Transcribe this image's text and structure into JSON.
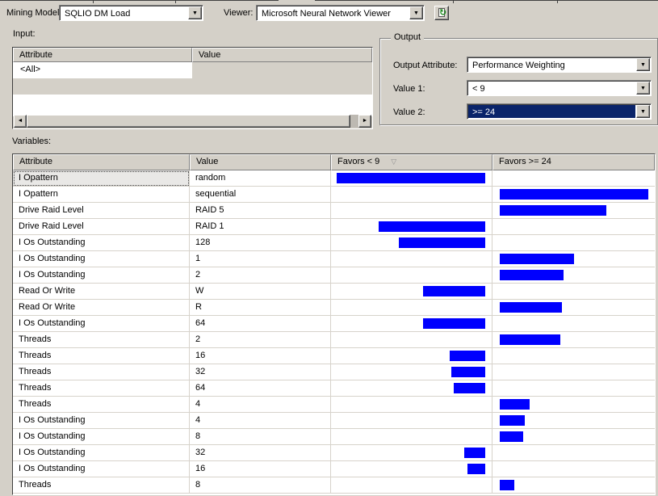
{
  "colors": {
    "bar": "#0000fe",
    "selection": "#0a246a",
    "chrome": "#d4d0c8"
  },
  "toolbar": {
    "mining_model_label": "Mining Model:",
    "mining_model_value": "SQLIO DM Load",
    "viewer_label": "Viewer:",
    "viewer_value": "Microsoft Neural Network Viewer"
  },
  "input": {
    "label": "Input:",
    "columns": [
      "Attribute",
      "Value"
    ],
    "rows": [
      {
        "attribute": "<All>",
        "value": ""
      }
    ]
  },
  "output": {
    "legend": "Output",
    "output_attribute_label": "Output Attribute:",
    "output_attribute_value": "Performance Weighting",
    "value1_label": "Value 1:",
    "value1_value": "< 9",
    "value2_label": "Value 2:",
    "value2_value": ">= 24"
  },
  "variables": {
    "label": "Variables:",
    "columns": [
      "Attribute",
      "Value",
      "Favors < 9",
      "Favors >= 24"
    ],
    "sorted_by": "Favors < 9",
    "rows": [
      {
        "attribute": "I Opattern",
        "value": "random",
        "favors": "lt",
        "size": 100,
        "selected": true
      },
      {
        "attribute": "I Opattern",
        "value": "sequential",
        "favors": "ge",
        "size": 100
      },
      {
        "attribute": "Drive Raid Level",
        "value": "RAID 5",
        "favors": "ge",
        "size": 72
      },
      {
        "attribute": "Drive Raid Level",
        "value": "RAID 1",
        "favors": "lt",
        "size": 72
      },
      {
        "attribute": "I Os Outstanding",
        "value": "128",
        "favors": "lt",
        "size": 58
      },
      {
        "attribute": "I Os Outstanding",
        "value": "1",
        "favors": "ge",
        "size": 50
      },
      {
        "attribute": "I Os Outstanding",
        "value": "2",
        "favors": "ge",
        "size": 43
      },
      {
        "attribute": "Read Or Write",
        "value": "W",
        "favors": "lt",
        "size": 42
      },
      {
        "attribute": "Read Or Write",
        "value": "R",
        "favors": "ge",
        "size": 42
      },
      {
        "attribute": "I Os Outstanding",
        "value": "64",
        "favors": "lt",
        "size": 42
      },
      {
        "attribute": "Threads",
        "value": "2",
        "favors": "ge",
        "size": 41
      },
      {
        "attribute": "Threads",
        "value": "16",
        "favors": "lt",
        "size": 24
      },
      {
        "attribute": "Threads",
        "value": "32",
        "favors": "lt",
        "size": 23
      },
      {
        "attribute": "Threads",
        "value": "64",
        "favors": "lt",
        "size": 21
      },
      {
        "attribute": "Threads",
        "value": "4",
        "favors": "ge",
        "size": 20
      },
      {
        "attribute": "I Os Outstanding",
        "value": "4",
        "favors": "ge",
        "size": 17
      },
      {
        "attribute": "I Os Outstanding",
        "value": "8",
        "favors": "ge",
        "size": 16
      },
      {
        "attribute": "I Os Outstanding",
        "value": "32",
        "favors": "lt",
        "size": 14
      },
      {
        "attribute": "I Os Outstanding",
        "value": "16",
        "favors": "lt",
        "size": 12
      },
      {
        "attribute": "Threads",
        "value": "8",
        "favors": "ge",
        "size": 10
      }
    ]
  }
}
